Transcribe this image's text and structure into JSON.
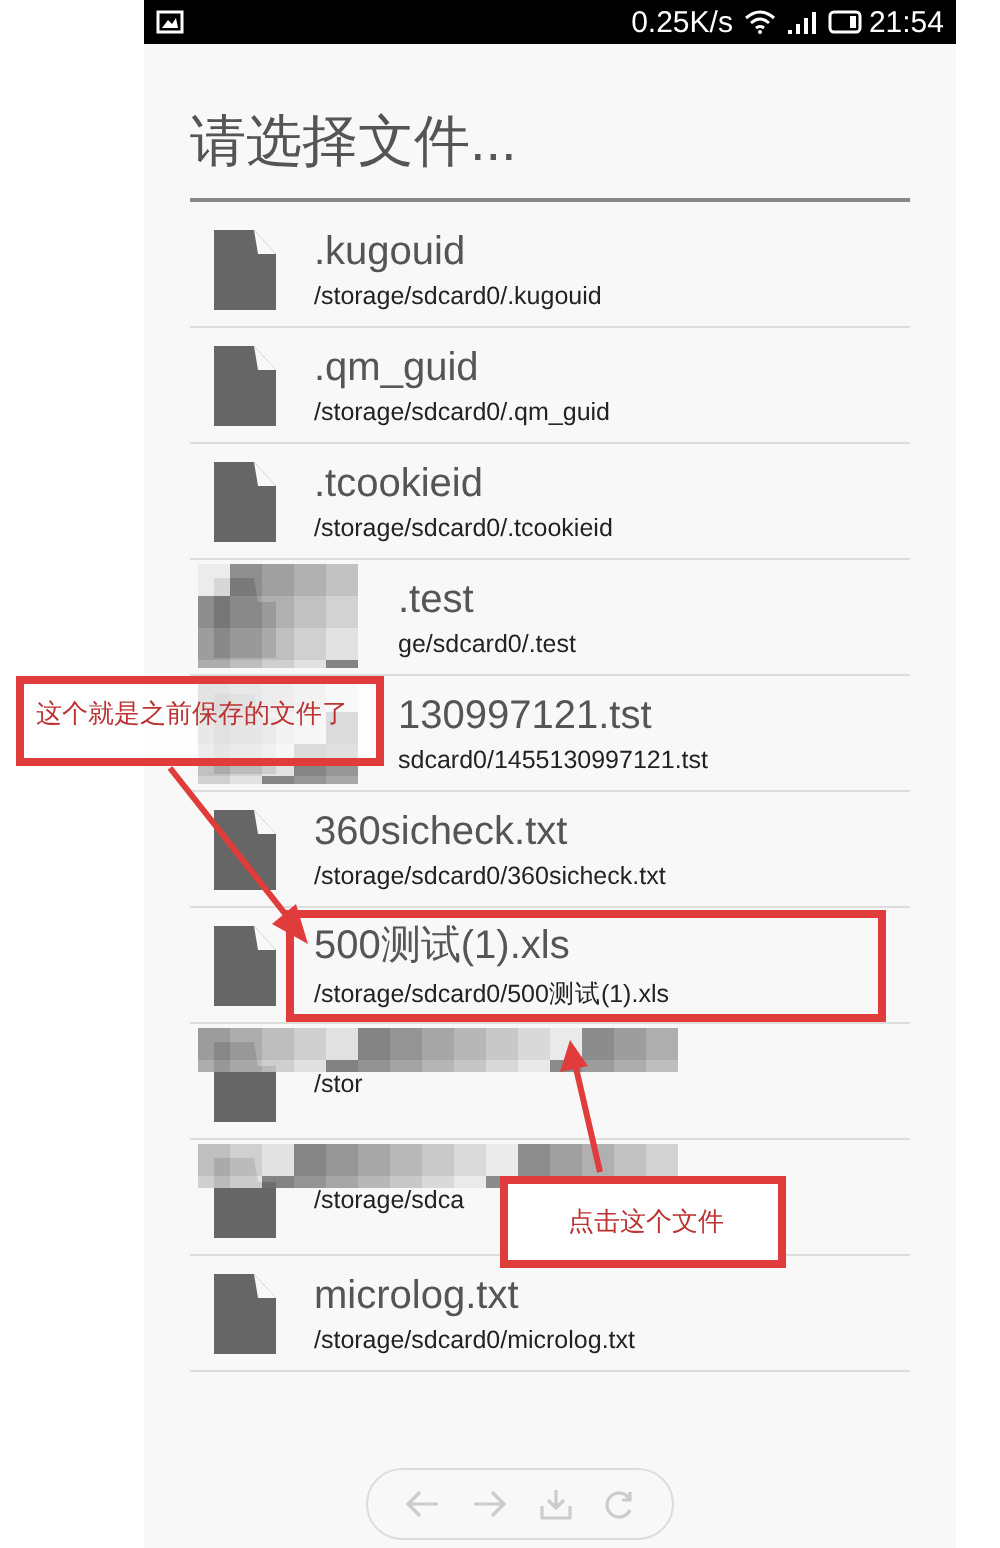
{
  "status_bar": {
    "speed": "0.25K/s",
    "time": "21:54"
  },
  "title": "请选择文件...",
  "files": [
    {
      "name": ".kugouid",
      "path": "/storage/sdcard0/.kugouid",
      "highlighted": false,
      "blurred": false
    },
    {
      "name": ".qm_guid",
      "path": "/storage/sdcard0/.qm_guid",
      "highlighted": false,
      "blurred": false
    },
    {
      "name": ".tcookieid",
      "path": "/storage/sdcard0/.tcookieid",
      "highlighted": false,
      "blurred": false
    },
    {
      "name": ".test",
      "path": "ge/sdcard0/.test",
      "highlighted": false,
      "blurred": true
    },
    {
      "name": "130997121.tst",
      "path": "sdcard0/1455130997121.tst",
      "highlighted": false,
      "blurred": true
    },
    {
      "name": "360sicheck.txt",
      "path": "/storage/sdcard0/360sicheck.txt",
      "highlighted": false,
      "blurred": false
    },
    {
      "name": "500测试(1).xls",
      "path": "/storage/sdcard0/500测试(1).xls",
      "highlighted": true,
      "blurred": false
    },
    {
      "path": "/stor",
      "highlighted": false,
      "blurred": true
    },
    {
      "path": "/storage/sdca",
      "highlighted": false,
      "blurred": true
    },
    {
      "name": "microlog.txt",
      "path": "/storage/sdcard0/microlog.txt",
      "highlighted": false,
      "blurred": false
    }
  ],
  "annotations": [
    {
      "text": "这个就是之前保存的文件了"
    },
    {
      "text": "点击这个文件"
    }
  ]
}
